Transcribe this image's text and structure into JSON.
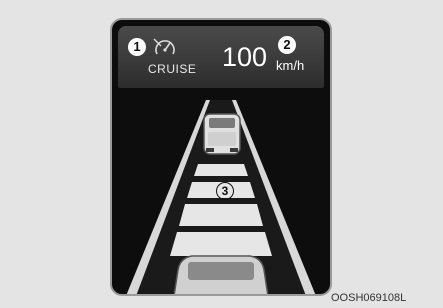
{
  "display": {
    "cruise_label": "CRUISE",
    "speed_value": "100",
    "speed_unit": "km/h",
    "callouts": [
      "1",
      "2",
      "3"
    ],
    "figure_code": "OOSH069108L"
  },
  "icons": {
    "cruise": "cruise-control-icon",
    "lead_vehicle": "lead-vehicle-icon",
    "own_vehicle": "own-vehicle-icon"
  }
}
